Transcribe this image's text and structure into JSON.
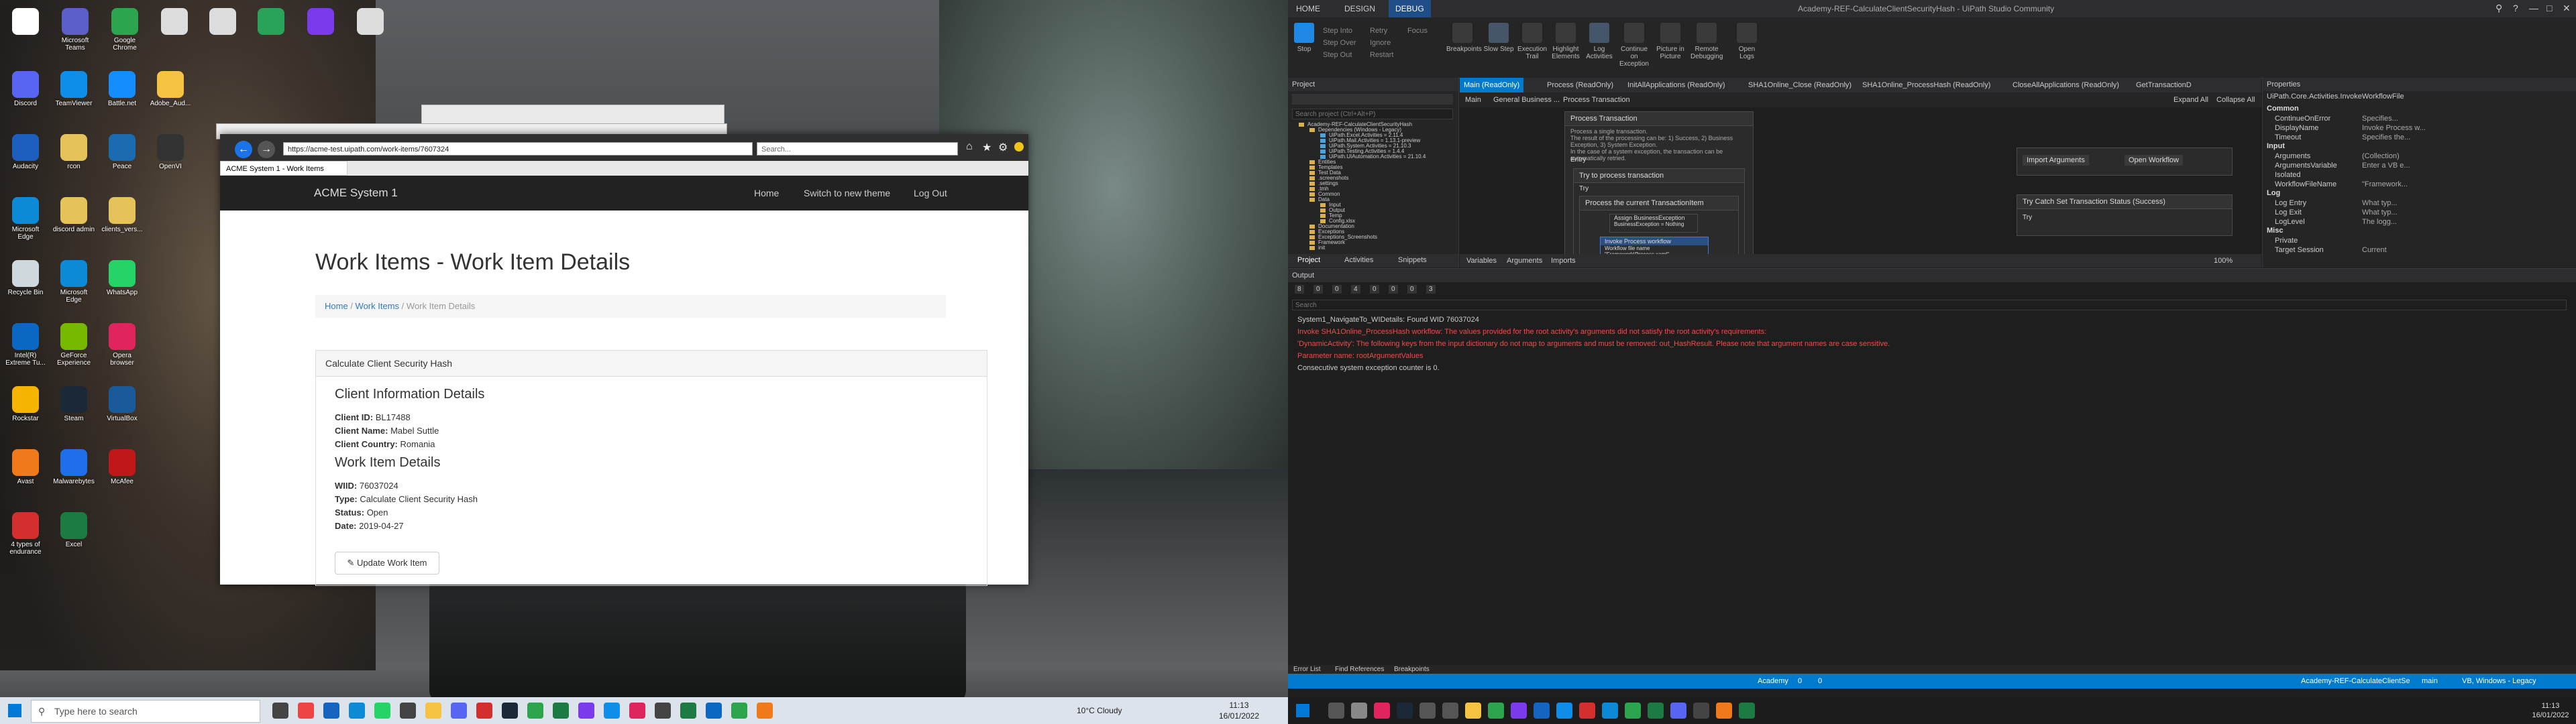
{
  "desktop": {
    "icons": [
      {
        "label": "",
        "color": "#ffffff"
      },
      {
        "label": "Microsoft Teams",
        "color": "#5b5fc7"
      },
      {
        "label": "Google Chrome",
        "color": "#2da44e"
      },
      {
        "label": "",
        "color": "#ddd"
      },
      {
        "label": "",
        "color": "#ddd"
      },
      {
        "label": "",
        "color": "#29a35a"
      },
      {
        "label": "",
        "color": "#7c3aed"
      },
      {
        "label": "",
        "color": "#ddd"
      },
      {
        "label": "Discord",
        "color": "#5865f2"
      },
      {
        "label": "TeamViewer",
        "color": "#0e8ee9"
      },
      {
        "label": "Battle.net",
        "color": "#148eff"
      },
      {
        "label": "Adobe_Aud...",
        "color": "#f5c242"
      },
      {
        "label": "Audacity",
        "color": "#1c5fbf"
      },
      {
        "label": "rcon",
        "color": "#e6c25a"
      },
      {
        "label": "Peace",
        "color": "#1b6bb0"
      },
      {
        "label": "OpenVI",
        "color": "#333"
      },
      {
        "label": "Microsoft Edge",
        "color": "#0c8ad6"
      },
      {
        "label": "discord admin",
        "color": "#e6c25a"
      },
      {
        "label": "clients_vers...",
        "color": "#e6c25a"
      },
      {
        "label": "Recycle Bin",
        "color": "#cfd8dc"
      },
      {
        "label": "Microsoft Edge",
        "color": "#0c8ad6"
      },
      {
        "label": "WhatsApp",
        "color": "#25d366"
      },
      {
        "label": "Intel(R) Extreme Tu...",
        "color": "#0a67c2"
      },
      {
        "label": "GeForce Experience",
        "color": "#76b900"
      },
      {
        "label": "Opera browser",
        "color": "#e0245e"
      },
      {
        "label": "Rockstar",
        "color": "#f5b400"
      },
      {
        "label": "Steam",
        "color": "#1b2838"
      },
      {
        "label": "VirtualBox",
        "color": "#1a5a9a"
      },
      {
        "label": "Avast",
        "color": "#f07a1a"
      },
      {
        "label": "Malwarebytes",
        "color": "#1f6feb"
      },
      {
        "label": "McAfee",
        "color": "#c01818"
      },
      {
        "label": "4 types of endurance",
        "color": "#d32f2f"
      },
      {
        "label": "Excel",
        "color": "#1d7a43"
      }
    ]
  },
  "taskbar_left": {
    "search_placeholder": "Type here to search",
    "weather": "10°C  Cloudy",
    "time": "11:13",
    "date": "16/01/2022"
  },
  "browser": {
    "url": "https://acme-test.uipath.com/work-items/7607324",
    "search_placeholder": "Search...",
    "tab_title": "ACME System 1 - Work Items",
    "brand": "ACME System 1",
    "nav": [
      "Home",
      "Switch to new theme",
      "Log Out"
    ],
    "page_title": "Work Items - Work Item Details",
    "breadcrumb": [
      "Home",
      "Work Items",
      "Work Item Details"
    ],
    "panel_title": "Calculate Client Security Hash",
    "client_section": "Client Information Details",
    "client_id_label": "Client ID:",
    "client_id": "BL17488",
    "client_name_label": "Client Name:",
    "client_name": "Mabel Suttle",
    "client_country_label": "Client Country:",
    "client_country": "Romania",
    "wi_section": "Work Item Details",
    "wiid_label": "WIID:",
    "wiid": "76037024",
    "type_label": "Type:",
    "type": "Calculate Client Security Hash",
    "status_label": "Status:",
    "status": "Open",
    "date_label": "Date:",
    "date": "2019-04-27",
    "update_button": "Update Work Item"
  },
  "studio": {
    "menu": [
      "HOME",
      "DESIGN",
      "DEBUG"
    ],
    "title": "Academy-REF-CalculateClientSecurityHash - UiPath Studio Community",
    "ribbon": {
      "stop": "Stop",
      "step_into": "Step Into",
      "step_over": "Step Over",
      "step_out": "Step Out",
      "retry": "Retry",
      "ignore": "Ignore",
      "restart": "Restart",
      "focus": "Focus",
      "breakpoints": "Breakpoints",
      "slow_step": "Slow Step",
      "execution_trail": "Execution Trail",
      "highlight": "Highlight Elements",
      "log_activities": "Log Activities",
      "continue_exception": "Continue on Exception",
      "picture": "Picture in Picture",
      "remote": "Remote Debugging",
      "open_logs": "Open Logs"
    },
    "project": {
      "title": "Project",
      "search_placeholder": "Search project (Ctrl+Alt+P)",
      "tree": [
        {
          "label": "Academy-REF-CalculateClientSecurityHash",
          "indent": 0
        },
        {
          "label": "Dependencies (Windows - Legacy)",
          "indent": 1
        },
        {
          "label": "UiPath.Excel.Activities = 2.11.4",
          "indent": 2
        },
        {
          "label": "UiPath.Mail.Activities = 1.13.1-preview",
          "indent": 2
        },
        {
          "label": "UiPath.System.Activities = 21.10.3",
          "indent": 2
        },
        {
          "label": "UiPath.Testing.Activities = 1.4.4",
          "indent": 2
        },
        {
          "label": "UiPath.UIAutomation.Activities = 21.10.4",
          "indent": 2
        },
        {
          "label": "Entities",
          "indent": 1
        },
        {
          "label": "Templates",
          "indent": 1
        },
        {
          "label": "Test Data",
          "indent": 1
        },
        {
          "label": ".screenshots",
          "indent": 1
        },
        {
          "label": ".settings",
          "indent": 1
        },
        {
          "label": ".tmh",
          "indent": 1
        },
        {
          "label": "Common",
          "indent": 1
        },
        {
          "label": "Data",
          "indent": 1
        },
        {
          "label": "Input",
          "indent": 2
        },
        {
          "label": "Output",
          "indent": 2
        },
        {
          "label": "Temp",
          "indent": 2
        },
        {
          "label": "Config.xlsx",
          "indent": 2
        },
        {
          "label": "Documentation",
          "indent": 1
        },
        {
          "label": "Exceptions",
          "indent": 1
        },
        {
          "label": "Exceptions_Screenshots",
          "indent": 1
        },
        {
          "label": "Framework",
          "indent": 1
        },
        {
          "label": "init",
          "indent": 1
        }
      ],
      "bottom_tabs": [
        "Project",
        "Activities",
        "Snippets"
      ]
    },
    "doc_tabs": [
      "Main (ReadOnly)",
      "Process (ReadOnly)",
      "InitAllApplications (ReadOnly)",
      "SHA1Online_Close (ReadOnly)",
      "SHA1Online_ProcessHash (ReadOnly)",
      "CloseAllApplications (ReadOnly)",
      "GetTransactionD"
    ],
    "breadcrumb": [
      "Main",
      "General Business ...",
      "Process Transaction"
    ],
    "expand_all": "Expand All",
    "collapse_all": "Collapse All",
    "canvas": {
      "process_transaction": "Process Transaction",
      "description": "Process a single transaction.\nThe result of the processing can be: 1) Success, 2) Business Exception, 3) System Exception.\nIn the case of a system exception, the transaction can be automatically retried.",
      "entry": "Entry",
      "try_process": "Try to process transaction",
      "try": "Try",
      "process_current": "Process the current TransactionItem",
      "assign_title": "Assign BusinessException",
      "assign_left": "BusinessException",
      "assign_right": "Nothing",
      "invoke_title": "Invoke Process workflow",
      "workflow_label": "Workflow file name",
      "workflow_value": "\"Framework\\Process.xaml\"",
      "import_args": "Import Arguments",
      "open_workflow": "Open Workflow",
      "catch_title": "Try Catch Set Transaction Status (Success)",
      "try_label2": "Try"
    },
    "designer_bottom": [
      "Variables",
      "Arguments",
      "Imports"
    ],
    "zoom": "100%",
    "properties": {
      "title": "Properties",
      "activity": "UiPath.Core.Activities.InvokeWorkflowFile",
      "rows": [
        {
          "cat": "Common"
        },
        {
          "k": "ContinueOnError",
          "v": "Specifies..."
        },
        {
          "k": "DisplayName",
          "v": "Invoke Process w..."
        },
        {
          "k": "Timeout",
          "v": "Specifies the..."
        },
        {
          "cat": "Input"
        },
        {
          "k": "Arguments",
          "v": "(Collection)"
        },
        {
          "k": "ArgumentsVariable",
          "v": "Enter a VB e..."
        },
        {
          "k": "Isolated",
          "v": ""
        },
        {
          "k": "WorkflowFileName",
          "v": "\"Framework..."
        },
        {
          "cat": "Log"
        },
        {
          "k": "Log Entry",
          "v": "What typ..."
        },
        {
          "k": "Log Exit",
          "v": "What typ..."
        },
        {
          "k": "LogLevel",
          "v": "The logg..."
        },
        {
          "cat": "Misc"
        },
        {
          "k": "Private",
          "v": ""
        },
        {
          "k": "Target Session",
          "v": "Current"
        }
      ]
    },
    "output": {
      "title": "Output",
      "counters": [
        "8",
        "0",
        "0",
        "4",
        "0",
        "0",
        "0",
        "3"
      ],
      "search_placeholder": "Search",
      "lines": [
        {
          "text": "System1_NavigateTo_WIDetails: Found WID 76037024",
          "color": "#cccccc"
        },
        {
          "text": "Invoke SHA1Online_ProcessHash workflow: The values provided for the root activity's arguments did not satisfy the root activity's requirements:",
          "color": "#f14c4c"
        },
        {
          "text": "'DynamicActivity': The following keys from the input dictionary do not map to arguments and must be removed: out_HashResult.  Please note that argument names are case sensitive.",
          "color": "#f14c4c"
        },
        {
          "text": "Parameter name: rootArgumentValues",
          "color": "#f14c4c"
        },
        {
          "text": "Consecutive system exception counter is 0.",
          "color": "#cccccc"
        }
      ],
      "tabs": [
        "Error List",
        "Find References",
        "Breakpoints"
      ]
    },
    "status_bar": {
      "orchestrator": "Academy",
      "errors": "0",
      "warnings": "0",
      "project": "Academy-REF-CalculateClientSe",
      "branch": "main",
      "lang": "VB, Windows - Legacy"
    },
    "taskbar": {
      "time": "11:13",
      "date": "16/01/2022"
    }
  }
}
